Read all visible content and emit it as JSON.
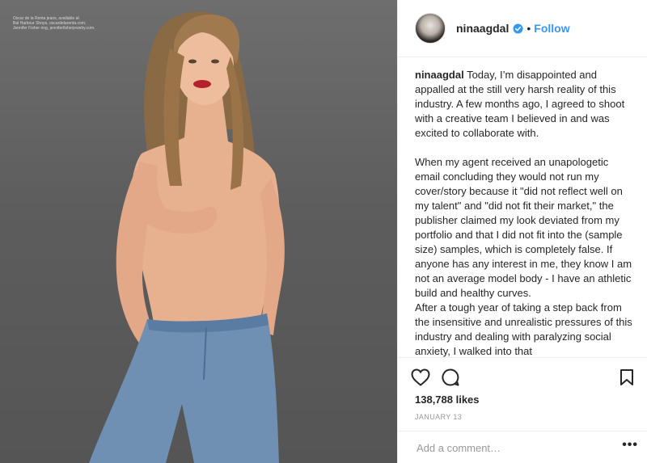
{
  "photo": {
    "credit_lines": [
      "Oscar de la Renta jeans, available at",
      "Bal Harbour Shops, oscardelarenta.com;",
      "Jennifer Fisher ring, jenniferfisherjewelry.com."
    ]
  },
  "header": {
    "username": "ninaagdal",
    "separator": "•",
    "follow_label": "Follow",
    "verified_icon": "verified-badge-icon"
  },
  "caption": {
    "username": "ninaagdal",
    "text": " Today, I’m disappointed and appalled at the still very harsh reality of this industry. A few months ago, I agreed to shoot with a creative team I believed in and was excited to collaborate with.\n\nWhen my agent received an unapologetic email concluding they would not run my cover/story because it \"did not reflect well on my talent\" and \"did not fit their market,\" the publisher claimed my look deviated from my portfolio and that I did not fit into the (sample size) samples, which is completely false. If anyone has any interest in me, they know I am not an average model body - I have an athletic build and healthy curves.\nAfter a tough year of taking a step back from the insensitive and unrealistic pressures of this industry and dealing with paralyzing social anxiety, I walked into that"
  },
  "actions": {
    "likes": "138,788 likes",
    "date": "JANUARY 13"
  },
  "comment": {
    "placeholder": "Add a comment…",
    "more_label": "•••"
  },
  "colors": {
    "accent": "#3897f0",
    "text": "#262626",
    "muted": "#999999",
    "border": "#efefef"
  }
}
